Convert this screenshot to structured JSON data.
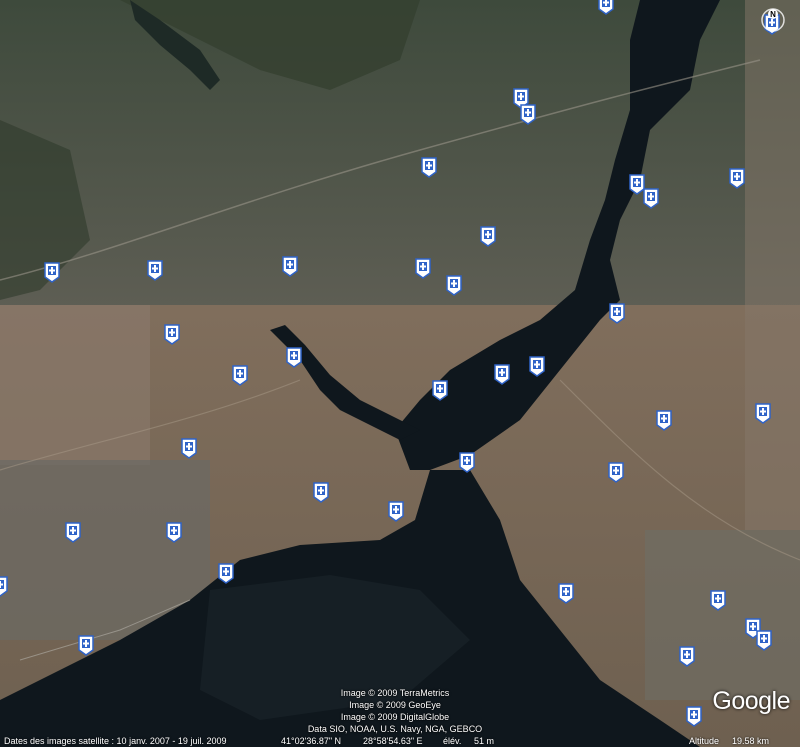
{
  "map": {
    "attribution": [
      "Image © 2009 TerraMetrics",
      "Image © 2009 GeoEye",
      "Image © 2009 DigitalGlobe",
      "Data SIO, NOAA, U.S. Navy, NGA, GEBCO"
    ],
    "logo": "Google",
    "compass_label": "N",
    "markers_icon": "hospital-placemark-icon"
  },
  "status": {
    "dates": "Dates des images satellite : 10 janv. 2007 - 19 juil. 2009",
    "lat": "41°02'36.87\" N",
    "lon": "28°58'54.63\" E",
    "elev_label": "élév.",
    "elev_value": "51 m",
    "alt_label": "Altitude",
    "alt_value": "19.58 km"
  },
  "colors": {
    "water": "#0d141a",
    "land_north": "#4a5242",
    "land_south": "#7a6a58",
    "marker_blue": "#2f63c8"
  }
}
